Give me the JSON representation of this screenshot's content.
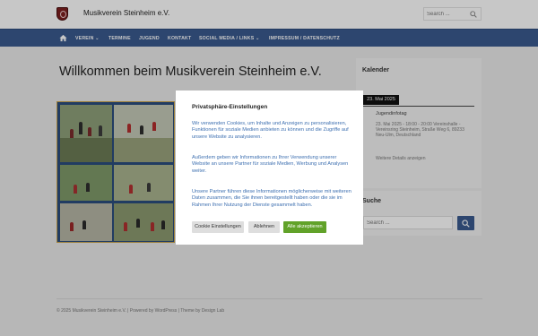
{
  "header": {
    "site_title": "Musikverein Steinheim e.V.",
    "search_placeholder": "Search ..."
  },
  "nav": {
    "items": [
      {
        "label": "VEREIN ⌄"
      },
      {
        "label": "TERMINE"
      },
      {
        "label": "JUGEND"
      },
      {
        "label": "KONTAKT"
      },
      {
        "label": "SOCIAL MEDIA / LINKS ⌄"
      },
      {
        "label": "IMPRESSUM / DATENSCHUTZ"
      }
    ]
  },
  "main": {
    "title": "Willkommen beim Musikverein Steinheim e.V."
  },
  "sidebar": {
    "calendar": {
      "title": "Kalender",
      "date": "23. Mai 2025",
      "event_title": "Jugendinfotag",
      "event_details": "23. Mai 2025 - 18:00 - 20:00 Vereinshalle - Vereinsring Steinheim, Straße Weg 6, 89233 Neu-Ulm, Deutschland",
      "more": "Weitere Details anzeigen"
    },
    "search": {
      "title": "Suche",
      "placeholder": "Search ..."
    }
  },
  "footer": {
    "text": "© 2025 Musikverein Steinheim e.V.  |  Powered by WordPress  |  Theme by Design Lab"
  },
  "consent": {
    "title": "Privatsphäre-Einstellungen",
    "paragraph1": "Wir verwenden Cookies, um Inhalte und Anzeigen zu personalisieren, Funktionen für soziale Medien anbieten zu können und die Zugriffe auf unsere Website zu analysieren.",
    "paragraph2": "Außerdem geben wir Informationen zu Ihrer Verwendung unserer Website an unsere Partner für soziale Medien, Werbung und Analysen weiter.",
    "paragraph3": "Unsere Partner führen diese Informationen möglicherweise mit weiteren Daten zusammen, die Sie ihnen bereitgestellt haben oder die sie im Rahmen Ihrer Nutzung der Dienste gesammelt haben.",
    "btn_settings": "Cookie Einstellungen",
    "btn_reject": "Ablehnen",
    "btn_accept": "Alle akzeptieren"
  },
  "colors": {
    "nav_bg": "#3a5a8f",
    "accept_green": "#61a229",
    "link_blue": "#3d6fb0"
  }
}
